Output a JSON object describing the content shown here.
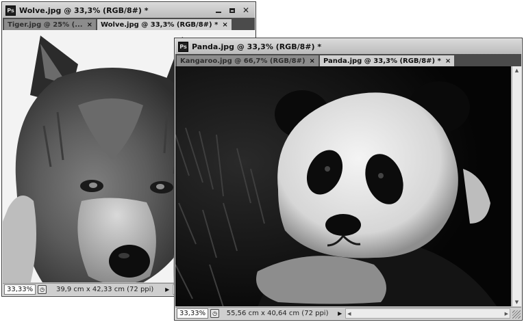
{
  "windows": {
    "wolf": {
      "title": "Wolve.jpg @ 33,3% (RGB/8#) *",
      "app_icon_label": "Ps",
      "tabs": [
        {
          "label": "Tiger.jpg @ 25% (...",
          "close": "×"
        },
        {
          "label": "Wolve.jpg @ 33,3% (RGB/8#) *",
          "close": "×"
        }
      ],
      "zoom": "33,33%",
      "doc_info": "39,9 cm x 42,33 cm (72 ppi)"
    },
    "panda": {
      "title": "Panda.jpg @ 33,3% (RGB/8#) *",
      "app_icon_label": "Ps",
      "tabs": [
        {
          "label": "Kangaroo.jpg @ 66,7% (RGB/8#)",
          "close": "×"
        },
        {
          "label": "Panda.jpg @ 33,3% (RGB/8#) *",
          "close": "×"
        }
      ],
      "zoom": "33,33%",
      "doc_info": "55,56 cm x 40,64 cm (72 ppi)"
    }
  },
  "controls": {
    "minimize": "",
    "maximize": "",
    "close": "✕",
    "info_icon": "◷",
    "status_arrow": "▶",
    "scroll_left": "◀",
    "scroll_right": "▶",
    "scroll_up": "▲",
    "scroll_down": "▼"
  },
  "colors": {
    "titlebar": "#cbcbcb",
    "tabbar": "#4b4b4b",
    "active_tab": "#d0d0d0",
    "inactive_tab": "#8c8c8c"
  }
}
